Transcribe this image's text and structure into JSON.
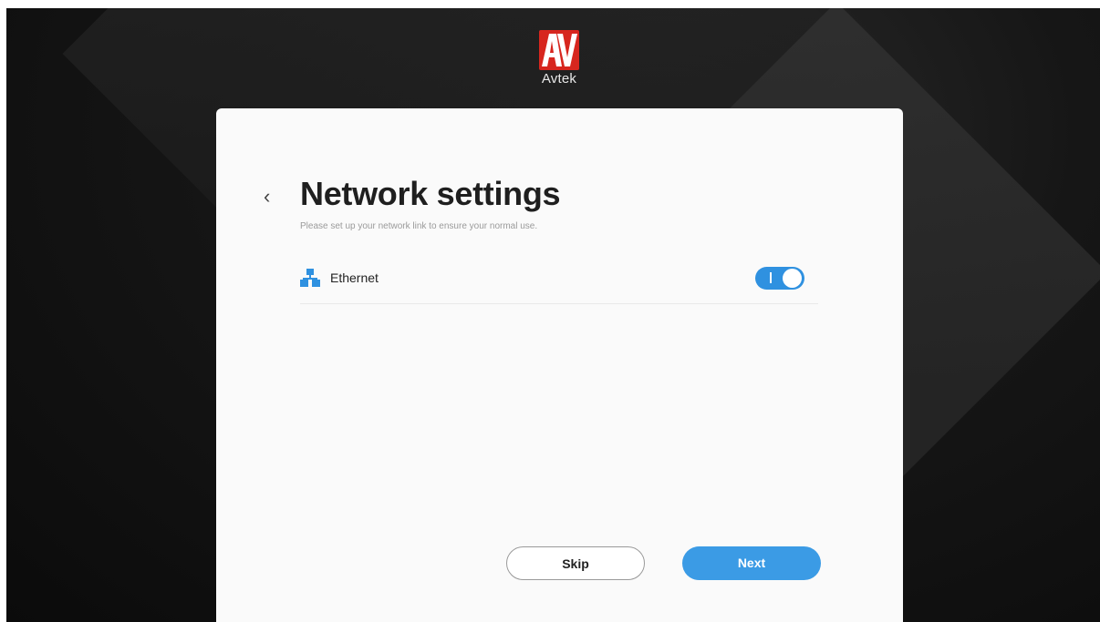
{
  "brand": {
    "name": "Avtek",
    "logo_letters": "AV",
    "accent_color": "#d7261e"
  },
  "page": {
    "back_icon": "chevron-left-icon",
    "title": "Network settings",
    "subtitle": "Please set up your network link to ensure your normal use."
  },
  "network": {
    "items": [
      {
        "label": "Ethernet",
        "icon": "ethernet-network-icon",
        "enabled": true
      }
    ],
    "toggle_color": "#2f91e0"
  },
  "actions": {
    "skip_label": "Skip",
    "next_label": "Next",
    "next_color": "#3b9be5"
  }
}
